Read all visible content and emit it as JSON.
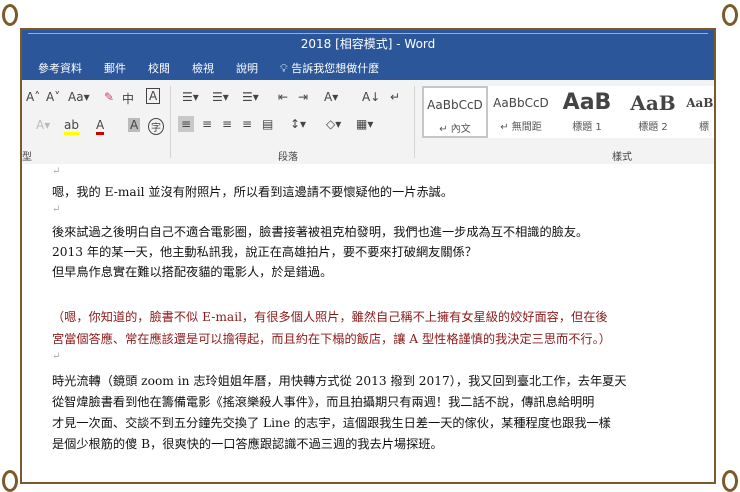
{
  "title": "2018 [相容模式]  -  Word",
  "menu": [
    "參考資料",
    "郵件",
    "校閱",
    "檢視",
    "說明"
  ],
  "tell_me": "告訴我您想做什麼",
  "groups": {
    "paragraph": "段落",
    "styles": "樣式"
  },
  "styles": [
    {
      "sample": "AaBbCcD",
      "label": "↵ 內文"
    },
    {
      "sample": "AaBbCcD",
      "label": "↵ 無間距"
    },
    {
      "sample": "AaB",
      "label": "標題 1"
    },
    {
      "sample": "AaB",
      "label": "標題 2"
    },
    {
      "sample": "AaBb",
      "label": "標"
    }
  ],
  "doc": {
    "l1": "嗯，我的 E-mail 並沒有附照片，所以看到這邊請不要懷疑他的一片赤誠。",
    "l2": "後來試過之後明白自己不適合電影圈，臉書接著被祖克柏發明，我們也進一步成為互不相識的臉友。",
    "l3": "2013 年的某一天，他主動私訊我，說正在高雄拍片，要不要來打破網友關係？",
    "l4": "但早鳥作息實在難以搭配夜貓的電影人，於是錯過。",
    "l5": "（嗯，你知道的，臉書不似 E-mail，有很多個人照片，雖然自己稱不上擁有女星級的姣好面容，但在後",
    "l6": "宮當個答應、常在應該還是可以擔得起，而且約在下榻的飯店，讓 A 型性格謹慎的我決定三思而不行。）",
    "l7": "時光流轉（鏡頭 zoom in 志玲姐姐年曆，用快轉方式從 2013 撥到 2017），我又回到臺北工作，去年夏天",
    "l8": "從智煒臉書看到他在籌備電影《搖滾樂殺人事件》，而且拍攝期只有兩週！我二話不說，傳訊息給明明",
    "l9": "才見一次面、交談不到五分鐘先交換了 Line 的志宇，這個跟我生日差一天的傢伙，某種程度也跟我一樣",
    "l10": "是個少根筋的傻 B，很爽快的一口答應跟認識不過三週的我去片場探班。"
  }
}
